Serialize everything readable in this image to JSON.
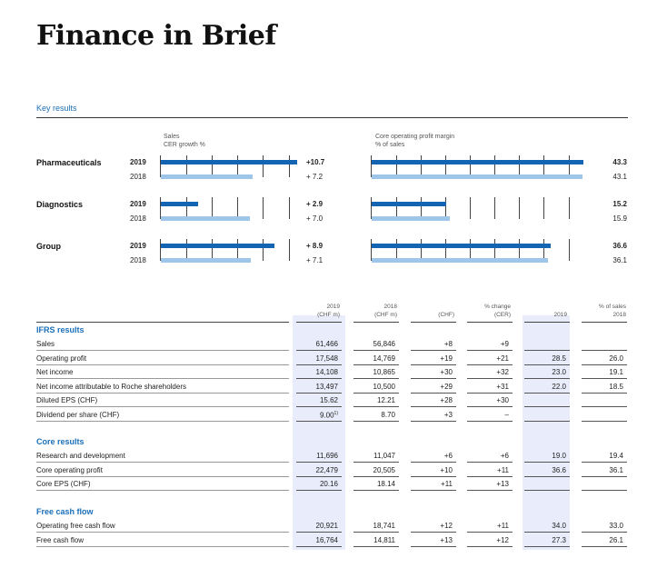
{
  "title": "Finance in Brief",
  "section": "Key results",
  "charts": {
    "left_header": [
      "Sales",
      "CER growth %"
    ],
    "right_header": [
      "Core operating profit margin",
      "% of sales"
    ],
    "segments": [
      {
        "name": "Pharmaceuticals",
        "rows": [
          {
            "year": "2019",
            "growth": "+10.7",
            "margin": "43.3"
          },
          {
            "year": "2018",
            "growth": "+ 7.2",
            "margin": "43.1"
          }
        ]
      },
      {
        "name": "Diagnostics",
        "rows": [
          {
            "year": "2019",
            "growth": "+ 2.9",
            "margin": "15.2"
          },
          {
            "year": "2018",
            "growth": "+ 7.0",
            "margin": "15.9"
          }
        ]
      },
      {
        "name": "Group",
        "rows": [
          {
            "year": "2019",
            "growth": "+ 8.9",
            "margin": "36.6"
          },
          {
            "year": "2018",
            "growth": "+ 7.1",
            "margin": "36.1"
          }
        ]
      }
    ],
    "growth_values": {
      "Pharmaceuticals": [
        10.7,
        7.2
      ],
      "Diagnostics": [
        2.9,
        7.0
      ],
      "Group": [
        8.9,
        7.1
      ]
    },
    "margin_values": {
      "Pharmaceuticals": [
        43.3,
        43.1
      ],
      "Diagnostics": [
        15.2,
        15.9
      ],
      "Group": [
        36.6,
        36.1
      ]
    },
    "colors": {
      "current": "#1464b4",
      "prior": "#9ec6e8"
    }
  },
  "table": {
    "headers": {
      "c1": [
        "2019",
        "(CHF m)"
      ],
      "c2": [
        "2018",
        "(CHF m)"
      ],
      "c3": [
        "",
        "(CHF)"
      ],
      "c4": [
        "% change",
        "(CER)"
      ],
      "c5": [
        "",
        "2019"
      ],
      "c6": [
        "% of sales",
        "2018"
      ]
    },
    "sections": [
      {
        "title": "IFRS results",
        "rows": [
          {
            "label": "Sales",
            "v": [
              "61,466",
              "56,846",
              "+8",
              "+9",
              "",
              ""
            ]
          },
          {
            "label": "Operating profit",
            "v": [
              "17,548",
              "14,769",
              "+19",
              "+21",
              "28.5",
              "26.0"
            ]
          },
          {
            "label": "Net income",
            "v": [
              "14,108",
              "10,865",
              "+30",
              "+32",
              "23.0",
              "19.1"
            ]
          },
          {
            "label": "Net income attributable to Roche shareholders",
            "v": [
              "13,497",
              "10,500",
              "+29",
              "+31",
              "22.0",
              "18.5"
            ]
          },
          {
            "label": "Diluted EPS (CHF)",
            "v": [
              "15.62",
              "12.21",
              "+28",
              "+30",
              "",
              ""
            ]
          },
          {
            "label": "Dividend per share (CHF)",
            "v": [
              "9.00",
              "8.70",
              "+3",
              "–",
              "",
              ""
            ],
            "sup": "1)"
          }
        ]
      },
      {
        "title": "Core results",
        "rows": [
          {
            "label": "Research and development",
            "v": [
              "11,696",
              "11,047",
              "+6",
              "+6",
              "19.0",
              "19.4"
            ]
          },
          {
            "label": "Core operating profit",
            "v": [
              "22,479",
              "20,505",
              "+10",
              "+11",
              "36.6",
              "36.1"
            ]
          },
          {
            "label": "Core EPS (CHF)",
            "v": [
              "20.16",
              "18.14",
              "+11",
              "+13",
              "",
              ""
            ]
          }
        ]
      },
      {
        "title": "Free cash flow",
        "rows": [
          {
            "label": "Operating free cash flow",
            "v": [
              "20,921",
              "18,741",
              "+12",
              "+11",
              "34.0",
              "33.0"
            ]
          },
          {
            "label": "Free cash flow",
            "v": [
              "16,764",
              "14,811",
              "+13",
              "+12",
              "27.3",
              "26.1"
            ]
          }
        ]
      }
    ]
  }
}
